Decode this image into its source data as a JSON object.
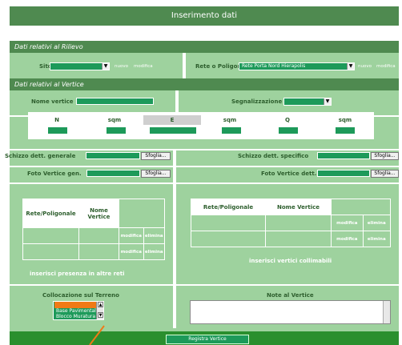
{
  "title": "Inserimento dati",
  "sections": {
    "rilievo": "Dati relativi al Rilievo",
    "vertice": "Dati relativi al Vertice"
  },
  "rilievo": {
    "sito_label": "Sito",
    "sito_value": "",
    "sito_links": {
      "nuovo": "nuovo",
      "modifica": "modifica"
    },
    "rete_label": "Rete o Poligonale",
    "rete_value": "Rete Porta Nord Hierapolis",
    "rete_links": {
      "nuovo": "nuovo",
      "modifica": "modifica"
    }
  },
  "vertice": {
    "nome_label": "Nome vertice",
    "nome_value": "",
    "segnalizzazione_label": "Segnalizzazione",
    "segnalizzazione_value": ""
  },
  "coords": {
    "headers": [
      "N",
      "sqm",
      "E",
      "sqm",
      "Q",
      "sqm"
    ],
    "values": [
      "",
      "",
      "",
      "",
      "",
      ""
    ]
  },
  "files": {
    "schizzo_generale_label": "Schizzo dett. generale",
    "schizzo_specifico_label": "Schizzo dett. specifico",
    "foto_generale_label": "Foto Vertice gen.",
    "foto_dettaglio_label": "Foto Vertice dett.",
    "browse_label": "Sfoglia..."
  },
  "reti_table": {
    "headers": [
      "Rete/Poligonale",
      "Nome Vertice"
    ],
    "rows": [
      {
        "rete": "",
        "vertice": "",
        "modifica": "modifica",
        "elimina": "elimina"
      },
      {
        "rete": "",
        "vertice": "",
        "modifica": "modifica",
        "elimina": "elimina"
      }
    ],
    "caption": "inserisci presenza in altre reti"
  },
  "collimabili_table": {
    "headers": [
      "Rete/Poligonale",
      "Nome Vertice"
    ],
    "rows": [
      {
        "rete": "",
        "vertice": "",
        "modifica": "modifica",
        "elimina": "elimina"
      },
      {
        "rete": "",
        "vertice": "",
        "modifica": "modifica",
        "elimina": "elimina"
      }
    ],
    "caption": "inserisci vertici collimabili"
  },
  "collocazione": {
    "label": "Collocazione sul Terreno",
    "options": [
      "",
      "Base Pavimentale",
      "Blocco Muratura"
    ],
    "selected_index": 0
  },
  "note": {
    "label": "Note al Vertice",
    "value": ""
  },
  "submit_label": "Registra Vertice",
  "colors": {
    "panel": "#9ed29e",
    "bar": "#4f8a50",
    "field": "#1d9a5a",
    "footer": "#2a8f2e",
    "highlight": "#f07a16"
  }
}
